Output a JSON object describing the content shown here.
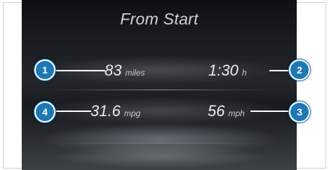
{
  "title": "From Start",
  "readouts": {
    "distance": {
      "value": "83",
      "unit": "miles"
    },
    "time": {
      "value": "1:30",
      "unit": "h"
    },
    "consumption": {
      "value": "31.6",
      "unit": "mpg"
    },
    "speed": {
      "value": "56",
      "unit": "mph"
    }
  },
  "callouts": {
    "distance": "1",
    "time": "2",
    "speed": "3",
    "consumption": "4"
  },
  "colors": {
    "callout_fill": "#1e78b4",
    "display_background": "#1b1e23",
    "text": "#e9ecef"
  }
}
